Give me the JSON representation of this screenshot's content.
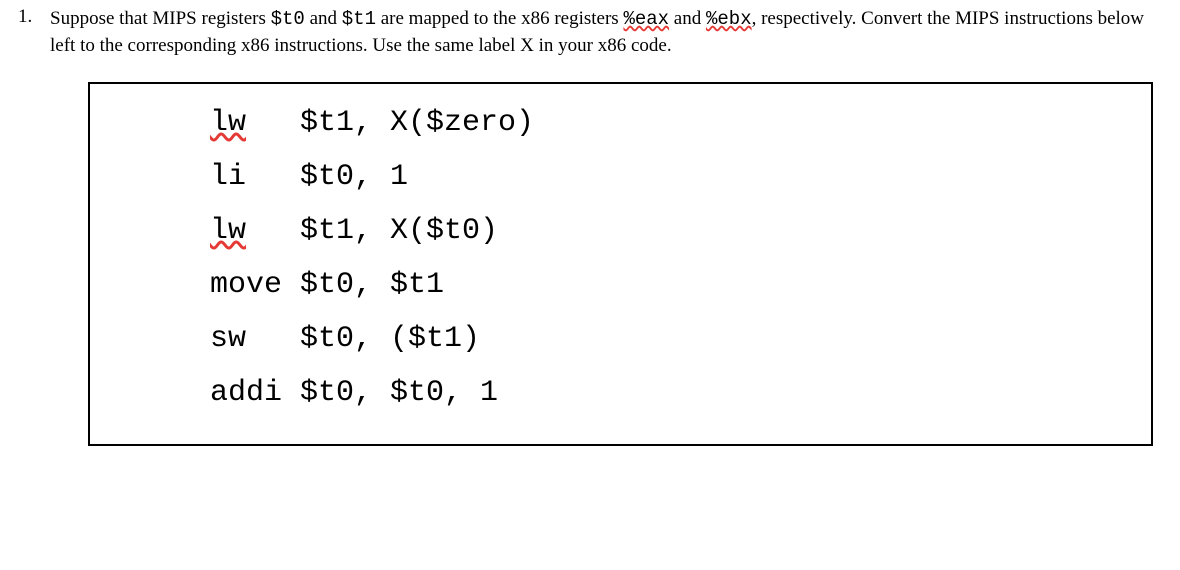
{
  "question": {
    "number": "1.",
    "part1": "Suppose that MIPS registers ",
    "reg_t0": "$t0",
    "part2": " and ",
    "reg_t1": "$t1",
    "part3": " are mapped to the x86 registers ",
    "reg_eax": "%eax",
    "part4": " and ",
    "reg_ebx": "%ebx",
    "part5": ", respectively. Convert the MIPS instructions below left to the corresponding x86 instructions. Use the same label X in your x86 code."
  },
  "code": {
    "l1_op": "lw",
    "l1_args": "$t1, X($zero)",
    "l2_op": "li",
    "l2_args": "$t0, 1",
    "l3_op": "lw",
    "l3_args": "$t1, X($t0)",
    "l4_op": "move",
    "l4_args": "$t0, $t1",
    "l5_op": "sw",
    "l5_args": "$t0, ($t1)",
    "l6_op": "addi",
    "l6_args": "$t0, $t0, 1"
  }
}
